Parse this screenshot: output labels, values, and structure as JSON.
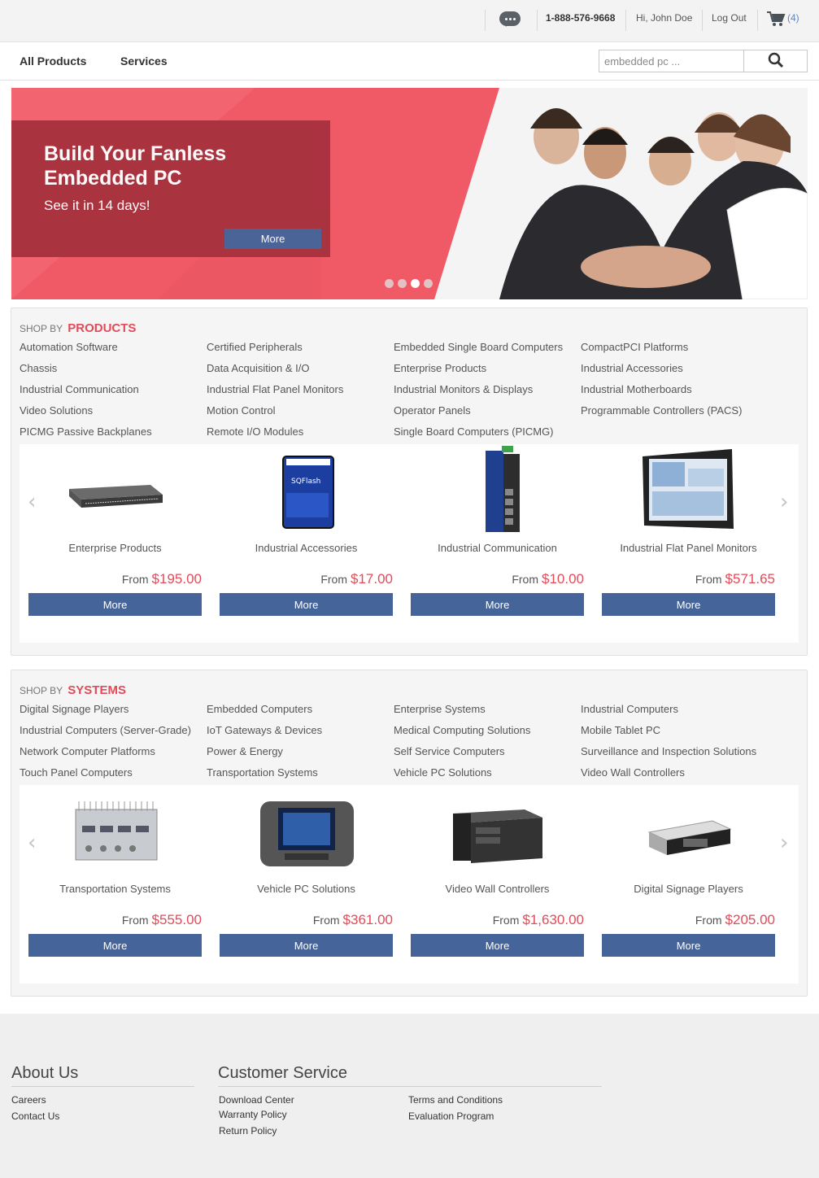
{
  "topbar": {
    "phone": "1-888-576-9668",
    "greeting": "Hi, John Doe",
    "logout": "Log Out",
    "cart_count": "(4)"
  },
  "nav": {
    "items": [
      "All Products",
      "Services"
    ],
    "search_placeholder": "embedded pc ..."
  },
  "hero": {
    "title": "Build Your Fanless Embedded PC",
    "subtitle": "See it in 14 days!",
    "button": "More",
    "slides": 4,
    "active_slide": 3
  },
  "products": {
    "heading_prefix": "SHOP BY",
    "heading": "PRODUCTS",
    "categories": [
      "Automation Software",
      "Certified Peripherals",
      "Embedded Single Board Computers",
      "CompactPCI Platforms",
      "Chassis",
      "Data Acquisition & I/O",
      "Enterprise Products",
      "Industrial Accessories",
      "Industrial Communication",
      "Industrial Flat Panel Monitors",
      "Industrial Monitors & Displays",
      "Industrial Motherboards",
      "Video Solutions",
      "Motion Control",
      "Operator Panels",
      "Programmable Controllers (PACS)",
      "PICMG Passive Backplanes",
      "Remote I/O Modules",
      "Single Board Computers (PICMG)"
    ],
    "items": [
      {
        "name": "Enterprise Products",
        "from": "From",
        "price": "$195.00",
        "button": "More"
      },
      {
        "name": "Industrial Accessories",
        "from": "From",
        "price": "$17.00",
        "button": "More"
      },
      {
        "name": "Industrial Communication",
        "from": "From",
        "price": "$10.00",
        "button": "More"
      },
      {
        "name": "Industrial Flat Panel Monitors",
        "from": "From",
        "price": "$571.65",
        "button": "More"
      }
    ]
  },
  "systems": {
    "heading_prefix": "SHOP BY",
    "heading": "SYSTEMS",
    "categories": [
      "Digital Signage Players",
      "Embedded Computers",
      "Enterprise Systems",
      "Industrial Computers",
      "Industrial Computers (Server-Grade)",
      "IoT Gateways & Devices",
      "Medical Computing Solutions",
      "Mobile Tablet PC",
      "Network Computer Platforms",
      "Power & Energy",
      "Self Service Computers",
      "Surveillance and Inspection Solutions",
      "Touch Panel Computers",
      "Transportation Systems",
      "Vehicle PC Solutions",
      "Video Wall Controllers"
    ],
    "items": [
      {
        "name": "Transportation Systems",
        "from": "From",
        "price": "$555.00",
        "button": "More"
      },
      {
        "name": "Vehicle PC Solutions",
        "from": "From",
        "price": "$361.00",
        "button": "More"
      },
      {
        "name": "Video Wall Controllers",
        "from": "From",
        "price": "$1,630.00",
        "button": "More"
      },
      {
        "name": "Digital Signage Players",
        "from": "From",
        "price": "$205.00",
        "button": "More"
      }
    ]
  },
  "footer": {
    "about": {
      "title": "About Us",
      "links": [
        "Careers",
        "Contact Us"
      ]
    },
    "service": {
      "title": "Customer Service",
      "links_col1": [
        "Download Center",
        "Warranty Policy",
        "Return Policy"
      ],
      "links_col2": [
        "Terms and Conditions",
        "Evaluation Program"
      ]
    }
  },
  "colors": {
    "accent": "#e14b5a",
    "button": "#45659a",
    "hero": "#ef5a66",
    "hero_card": "#a8323f"
  },
  "icons": [
    "chat-icon",
    "cart-icon",
    "search-icon",
    "chevron-left-icon",
    "chevron-right-icon"
  ]
}
